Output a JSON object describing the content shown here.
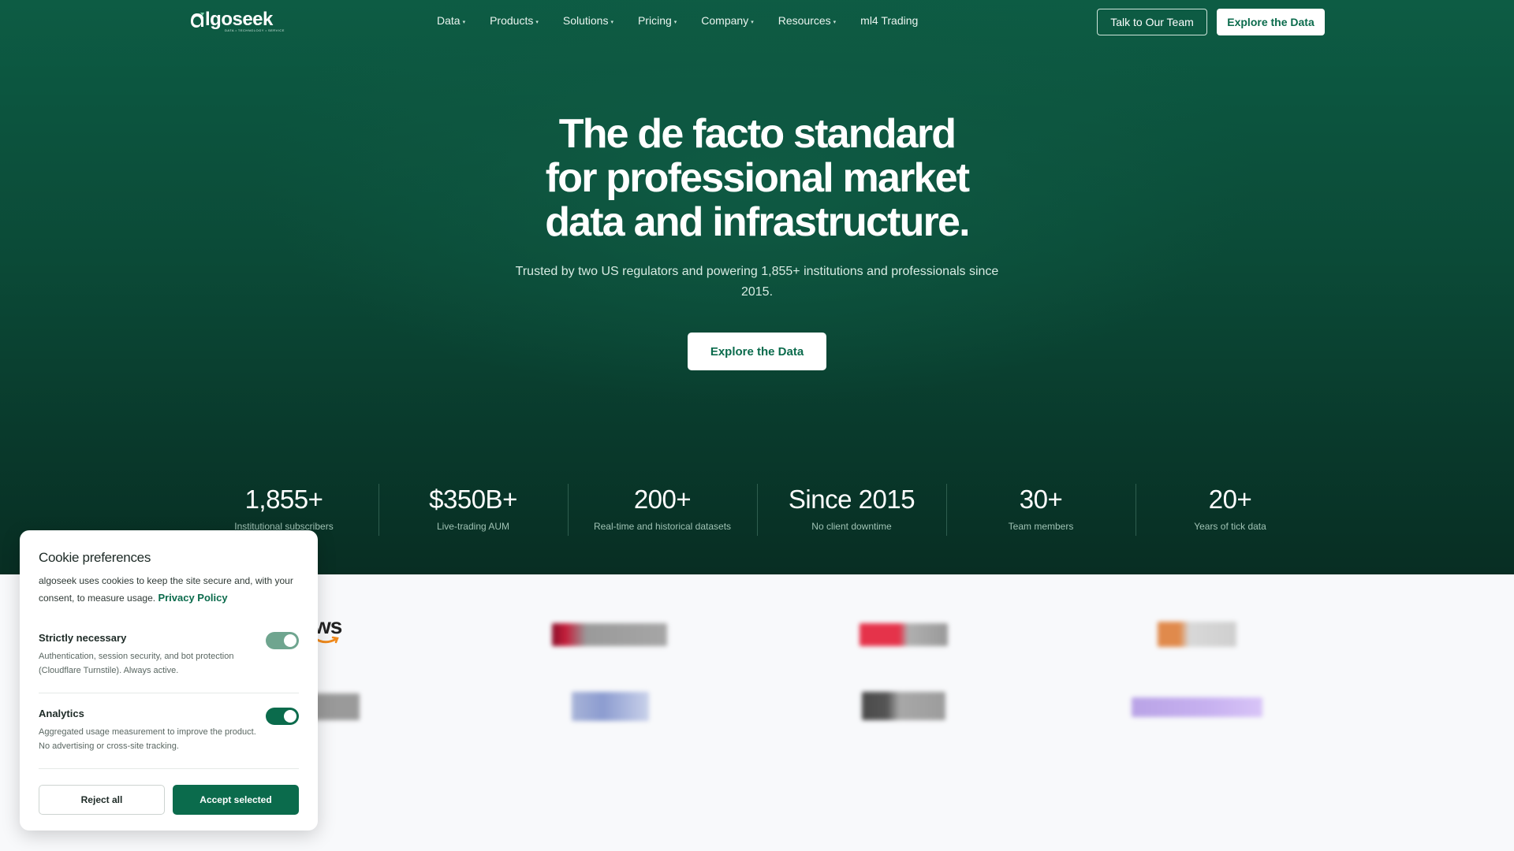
{
  "brand": {
    "logo_text": "lgoseek",
    "logo_tagline": "DATA • TECHNOLOGY • SERVICE",
    "accent": "#0b6b4c"
  },
  "nav": {
    "items": [
      {
        "label": "Data",
        "has_dropdown": true
      },
      {
        "label": "Products",
        "has_dropdown": true
      },
      {
        "label": "Solutions",
        "has_dropdown": true
      },
      {
        "label": "Pricing",
        "has_dropdown": true
      },
      {
        "label": "Company",
        "has_dropdown": true
      },
      {
        "label": "Resources",
        "has_dropdown": true
      },
      {
        "label": "ml4 Trading",
        "has_dropdown": false
      }
    ],
    "caret": "▾",
    "talk_button": "Talk to Our Team",
    "explore_button": "Explore the Data"
  },
  "hero": {
    "headline_line1": "The de facto standard",
    "headline_line2": "for professional market",
    "headline_line3": "data and infrastructure.",
    "subline": "Trusted by two US regulators and powering 1,855+ institutions and professionals since 2015.",
    "cta": "Explore the Data"
  },
  "stats": [
    {
      "value": "1,855+",
      "label": "Institutional subscribers"
    },
    {
      "value": "$350B+",
      "label": "Live-trading AUM"
    },
    {
      "value": "200+",
      "label": "Real-time and historical datasets"
    },
    {
      "value": "Since 2015",
      "label": "No client downtime"
    },
    {
      "value": "30+",
      "label": "Team members"
    },
    {
      "value": "20+",
      "label": "Years of tick data"
    }
  ],
  "partners": {
    "first_logo_text": "ws"
  },
  "cookie": {
    "title": "Cookie preferences",
    "body": "algoseek uses cookies to keep the site secure and, with your consent, to measure usage.",
    "privacy_link": "Privacy Policy",
    "strict_title": "Strictly necessary",
    "strict_desc": "Authentication, session security, and bot protection (Cloudflare Turnstile). Always active.",
    "strict_enabled": true,
    "analytics_title": "Analytics",
    "analytics_desc": "Aggregated usage measurement to improve the product. No advertising or cross-site tracking.",
    "analytics_enabled": true,
    "reject_button": "Reject all",
    "accept_button": "Accept selected"
  }
}
